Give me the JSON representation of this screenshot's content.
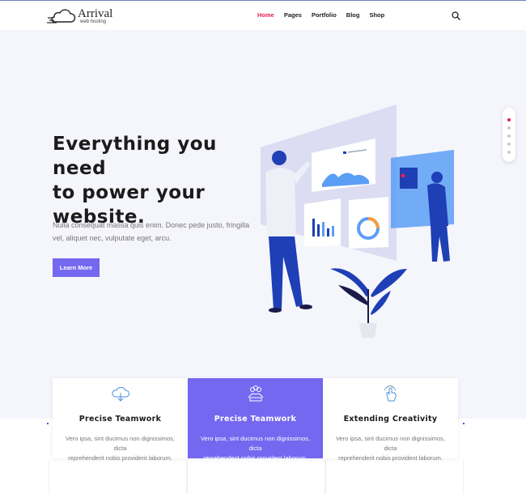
{
  "brand": {
    "name": "Arrival",
    "tagline": "web hosting"
  },
  "nav": {
    "items": [
      {
        "label": "Home",
        "active": true
      },
      {
        "label": "Pages"
      },
      {
        "label": "Portfolio"
      },
      {
        "label": "Blog"
      },
      {
        "label": "Shop"
      }
    ]
  },
  "hero": {
    "headline_lines": [
      "Everything you need",
      "to power your",
      "website."
    ],
    "subtext_lines": [
      "Nulla consequat massa quis enim. Donec pede justo, fringilla",
      "vel, aliquet nec, vulputate eget, arcu."
    ],
    "cta_label": "Learn More"
  },
  "features": [
    {
      "title": "Precise Teamwork",
      "text_lines": [
        "Vero ipsa, sint ducimus non dignissimos, dicta",
        "reprehenderit nobis provident laborum."
      ],
      "icon": "cloud-download-icon",
      "highlighted": false
    },
    {
      "title": "Precise Teamwork",
      "text_lines": [
        "Vero ipsa, sint ducimus non dignissimos, dicta",
        "reprehenderit nobis provident laborum."
      ],
      "icon": "team-icon",
      "highlighted": true
    },
    {
      "title": "Extending Creativity",
      "text_lines": [
        "Vero ipsa, sint ducimus non dignissimos, dicta",
        "reprehenderit nobis provident laborum."
      ],
      "icon": "hand-touch-icon",
      "highlighted": false
    }
  ],
  "slider": {
    "active_index": 0,
    "count": 5
  },
  "colors": {
    "accent": "#7468f0",
    "active_nav": "#e5204c",
    "hero_bg": "#f5f5fc",
    "illustration_blue": "#1e3fb5"
  }
}
